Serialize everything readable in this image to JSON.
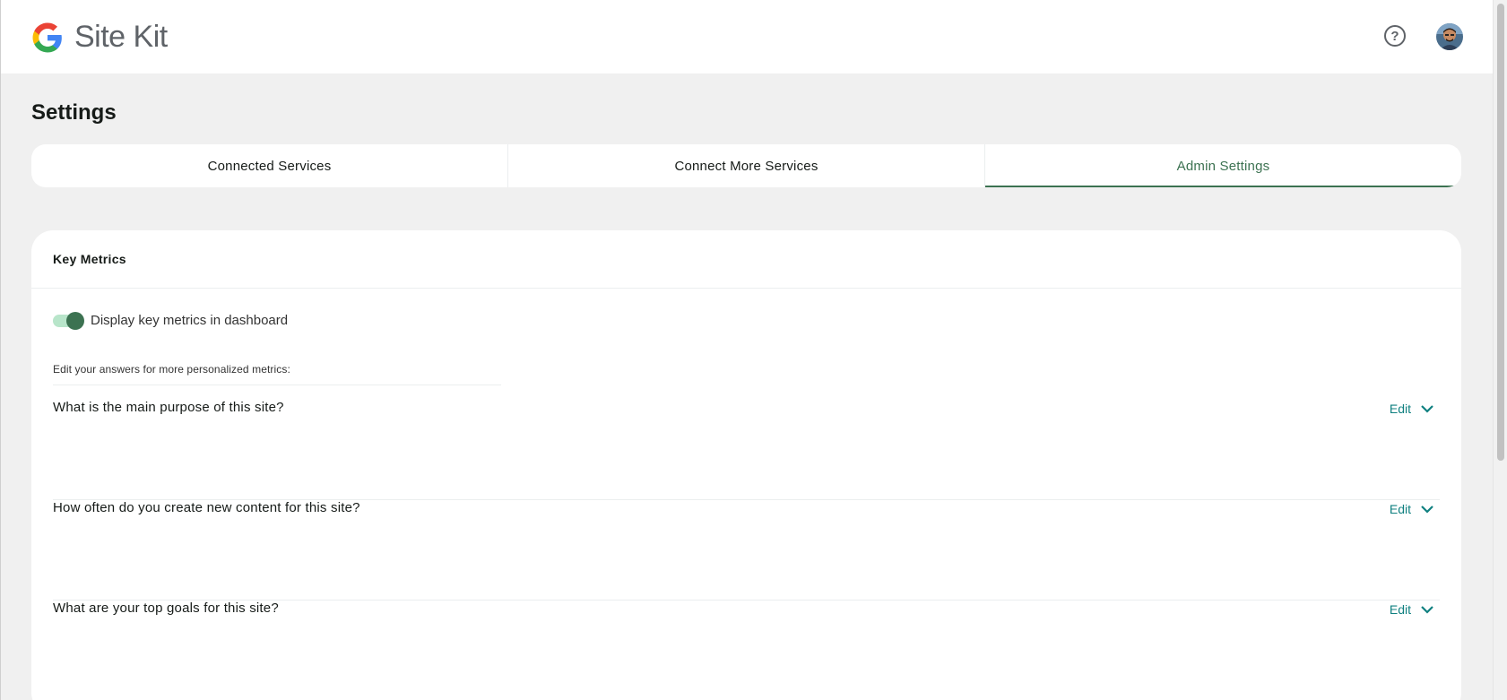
{
  "header": {
    "brand": "Site Kit",
    "help_icon": "help-circle-icon",
    "help_glyph": "?",
    "avatar_icon": "user-avatar"
  },
  "page": {
    "title": "Settings"
  },
  "tabs": [
    {
      "label": "Connected Services",
      "active": false
    },
    {
      "label": "Connect More Services",
      "active": false
    },
    {
      "label": "Admin Settings",
      "active": true
    }
  ],
  "key_metrics": {
    "title": "Key Metrics",
    "toggle_label": "Display key metrics in dashboard",
    "toggle_on": true,
    "hint": "Edit your answers for more personalized metrics:",
    "questions": [
      {
        "text": "What is the main purpose of this site?",
        "edit_label": "Edit"
      },
      {
        "text": "How often do you create new content for this site?",
        "edit_label": "Edit"
      },
      {
        "text": "What are your top goals for this site?",
        "edit_label": "Edit"
      }
    ]
  },
  "colors": {
    "accent": "#3c7251",
    "edit_link": "#108080",
    "background": "#f0f0f0"
  }
}
